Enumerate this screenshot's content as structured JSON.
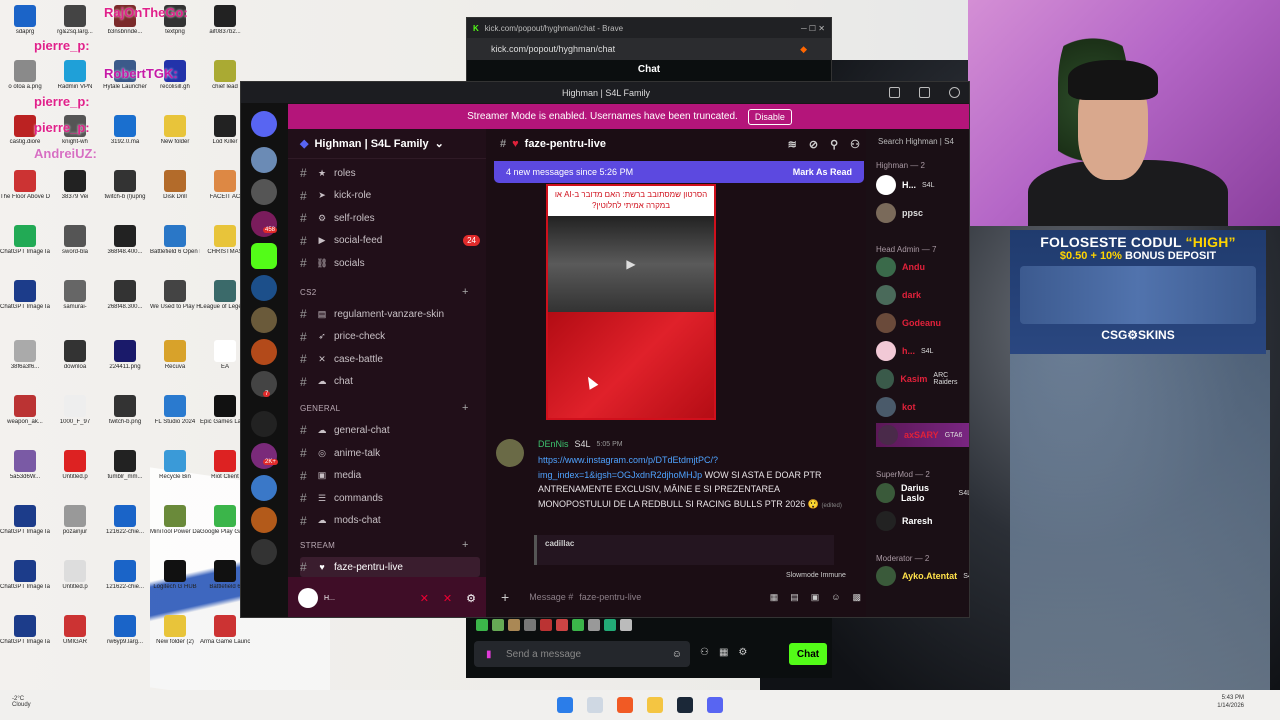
{
  "desktop": {
    "icons": [
      {
        "label": "sdaprg",
        "color": "#1b64c8"
      },
      {
        "label": "rg&2sq.larg...",
        "color": "#444"
      },
      {
        "label": "b3nsbrinde...",
        "color": "#7b2a2a"
      },
      {
        "label": "textpng",
        "color": "#333"
      },
      {
        "label": "aif0837b2...",
        "color": "#222"
      },
      {
        "label": "o otoa a.png",
        "color": "#8a8a8a"
      },
      {
        "label": "Radmin VPN",
        "color": "#1fa0d8"
      },
      {
        "label": "Hytale Launcher",
        "color": "#3b5a8a"
      },
      {
        "label": "recolisill.gh",
        "color": "#23a"
      },
      {
        "label": "chief lead",
        "color": "#aa3"
      },
      {
        "label": "castig.diore",
        "color": "#b22"
      },
      {
        "label": "knight-wh",
        "color": "#555"
      },
      {
        "label": "3192.0.ma",
        "color": "#1a6fcf"
      },
      {
        "label": "New folder",
        "color": "#e8c43a"
      },
      {
        "label": "Lod Killer",
        "color": "#222"
      },
      {
        "label": "The Floor Above Demo",
        "color": "#c33"
      },
      {
        "label": "38379 Vei",
        "color": "#222"
      },
      {
        "label": "twitch-b (l)upng",
        "color": "#333"
      },
      {
        "label": "Disk Drill",
        "color": "#b36b2a"
      },
      {
        "label": "FACEIT AC",
        "color": "#d84"
      },
      {
        "label": "ChatGPT Image Ian...",
        "color": "#2a5"
      },
      {
        "label": "sword-bla",
        "color": "#555"
      },
      {
        "label": "368f48.400...",
        "color": "#222"
      },
      {
        "label": "Battlefield 6 Open Beta",
        "color": "#2a77c7"
      },
      {
        "label": "CHRISTMAS",
        "color": "#e8c43a"
      },
      {
        "label": "ChatGPT Image Ian...",
        "color": "#1c3c8a"
      },
      {
        "label": "samurai-",
        "color": "#666"
      },
      {
        "label": "268f48.300...",
        "color": "#333"
      },
      {
        "label": "We Used to Play Here",
        "color": "#444"
      },
      {
        "label": "League of Legends",
        "color": "#3b6a6a"
      },
      {
        "label": "38f6a3f6...",
        "color": "#aaa"
      },
      {
        "label": "downloa",
        "color": "#333"
      },
      {
        "label": "224411.png",
        "color": "#1a1a6a"
      },
      {
        "label": "Recuva",
        "color": "#d8a22a"
      },
      {
        "label": "EA",
        "color": "#fff"
      },
      {
        "label": "weapon_ak...",
        "color": "#b33"
      },
      {
        "label": "1000_F_97",
        "color": "#eee"
      },
      {
        "label": "twitch-b.png",
        "color": "#333"
      },
      {
        "label": "FL Studio 2024",
        "color": "#2a7acf"
      },
      {
        "label": "Epic Games Launcher",
        "color": "#111"
      },
      {
        "label": "5a53d6W...",
        "color": "#7a5aa5"
      },
      {
        "label": "Untitled.p",
        "color": "#d22"
      },
      {
        "label": "tumblr_mm...",
        "color": "#222"
      },
      {
        "label": "Recycle Bin",
        "color": "#3a9ad8"
      },
      {
        "label": "Riot Client",
        "color": "#d22"
      },
      {
        "label": "ChatGPT Image Ian...",
        "color": "#1c3c8a"
      },
      {
        "label": "pozainjur",
        "color": "#999"
      },
      {
        "label": "121622-chie...",
        "color": "#1a64c8"
      },
      {
        "label": "MiniTool Power Data...",
        "color": "#6a8a3a"
      },
      {
        "label": "Google Play Games",
        "color": "#3bb54a"
      },
      {
        "label": "ChatGPT Image Ian...",
        "color": "#1c3c8a"
      },
      {
        "label": "Untitled.p",
        "color": "#ddd"
      },
      {
        "label": "121622-chie...",
        "color": "#1a64c8"
      },
      {
        "label": "Logitech G HUB",
        "color": "#111"
      },
      {
        "label": "Battlefield 6",
        "color": "#111"
      },
      {
        "label": "ChatGPT Image Ian...",
        "color": "#1c3c8a"
      },
      {
        "label": "UMIGAR",
        "color": "#c33"
      },
      {
        "label": "rw6yp9.larg...",
        "color": "#1a64c8"
      },
      {
        "label": "New folder (2)",
        "color": "#e8c43a"
      },
      {
        "label": "Arma Game Launcher",
        "color": "#c33"
      },
      {
        "label": "g36f44ae5...",
        "color": "#aaa"
      },
      {
        "label": "asdadasd.txt",
        "color": "#eee"
      },
      {
        "label": "Radmin VP...",
        "color": "#1fa0d8"
      },
      {
        "label": "hytale-laun...",
        "color": "#3b5a8a"
      }
    ],
    "overlay_names": [
      "RajOnTheGo:",
      "pierre_p:",
      "RobertTGK:",
      "pierre_p:",
      "pierre_p:",
      "AndreiUZ:"
    ]
  },
  "kick": {
    "tab_title": "kick.com/popout/hyghman/chat - Brave",
    "url": "kick.com/popout/hyghman/chat",
    "chat_header": "Chat",
    "send_placeholder": "Send a message",
    "chat_button": "Chat",
    "accent": "#53fc18"
  },
  "discord": {
    "window_title": "Highman | S4L Family",
    "banner_text": "Streamer Mode is enabled. Usernames have been truncated.",
    "banner_button": "Disable",
    "server_name": "Highman | S4L Family",
    "rail_badges": [
      "458",
      "7",
      "2K+"
    ],
    "channels": [
      {
        "emoji": "★",
        "name": "roles"
      },
      {
        "emoji": "➤",
        "name": "kick-role"
      },
      {
        "emoji": "⚙",
        "name": "self-roles"
      },
      {
        "emoji": "▶",
        "name": "social-feed",
        "count": "24"
      },
      {
        "emoji": "⛓",
        "name": "socials"
      }
    ],
    "cat_cs2": "CS2",
    "cs2_channels": [
      {
        "emoji": "▤",
        "name": "regulament-vanzare-skin"
      },
      {
        "emoji": "➶",
        "name": "price-check"
      },
      {
        "emoji": "✕",
        "name": "case-battle"
      },
      {
        "emoji": "☁",
        "name": "chat"
      }
    ],
    "cat_general": "GENERAL",
    "general_channels": [
      {
        "emoji": "☁",
        "name": "general-chat"
      },
      {
        "emoji": "◎",
        "name": "anime-talk"
      },
      {
        "emoji": "▣",
        "name": "media"
      },
      {
        "emoji": "☰",
        "name": "commands"
      },
      {
        "emoji": "☁",
        "name": "mods-chat"
      }
    ],
    "cat_stream": "STREAM",
    "stream_channels": [
      {
        "emoji": "♥",
        "name": "faze-pentru-live"
      }
    ],
    "user_short": "H...",
    "current_channel": "faze-pentru-live",
    "new_messages": "4 new messages since 5:26 PM",
    "mark_as_read": "Mark As Read",
    "media_header": "הסרטון שמסתובב ברשת: האם מדובר ב-AI או במקרה אמיתי לחלוטין?",
    "message": {
      "author": "DEnNis",
      "tag": "S4L",
      "time": "5:05 PM",
      "link": "https://www.instagram.com/p/DTdEtdmjtPC/?img_index=1&igsh=OGJxdnR2djhoMHJp",
      "text": "WOW SI ASTA E DOAR PTR ANTRENAMENTE EXCLUSIV, MÂINE E SI PREZENTAREA MONOPOSTULUI DE LA REDBULL SI RACING BULLS PTR 2026 😲",
      "edited": "(edited)"
    },
    "embed_author": "cadillac",
    "slowmode": "Slowmode Immune",
    "input_placeholder": "Message #",
    "input_channel": "faze-pentru-live",
    "search": "Search Highman | S4",
    "member_groups": [
      {
        "label": "Highman — 2"
      },
      {
        "label": "Head Admin — 7"
      },
      {
        "label": "SuperMod — 2"
      },
      {
        "label": "Moderator — 2"
      }
    ],
    "members": [
      {
        "name": "H...",
        "tag": "S4L",
        "color": "#ffffff"
      },
      {
        "name": "ppsc",
        "tag": "",
        "color": "#dddddd"
      },
      {
        "name": "Andu",
        "tag": "",
        "color": "#e0213a"
      },
      {
        "name": "dark",
        "tag": "",
        "color": "#e0213a"
      },
      {
        "name": "Godeanu",
        "tag": "",
        "color": "#e0213a"
      },
      {
        "name": "h...",
        "tag": "S4L",
        "color": "#e0213a"
      },
      {
        "name": "Kasim",
        "tag": "ARC Raiders",
        "color": "#e0213a"
      },
      {
        "name": "kot",
        "tag": "",
        "color": "#e0213a"
      },
      {
        "name": "axSARY",
        "tag": "GTA6",
        "color": "#e0213a"
      },
      {
        "name": "Darius Laslo",
        "tag": "S4L",
        "color": "#ffffff"
      },
      {
        "name": "Raresh",
        "tag": "",
        "color": "#ffffff"
      },
      {
        "name": "Ayko.Atentat",
        "tag": "S4L",
        "color": "#ffe14a"
      }
    ],
    "accent": "#b4157a"
  },
  "promo": {
    "line1a": "FOLOSESTE CODUL",
    "line1b": "“HIGH”",
    "line2a": "$0.50 + 10%",
    "line2b": "BONUS DEPOSIT",
    "logo": "CSG⚙SKINS"
  },
  "taskbar": {
    "weather_temp": "-2°C",
    "weather_cond": "Cloudy",
    "time": "5:43 PM",
    "date": "1/14/2026"
  }
}
